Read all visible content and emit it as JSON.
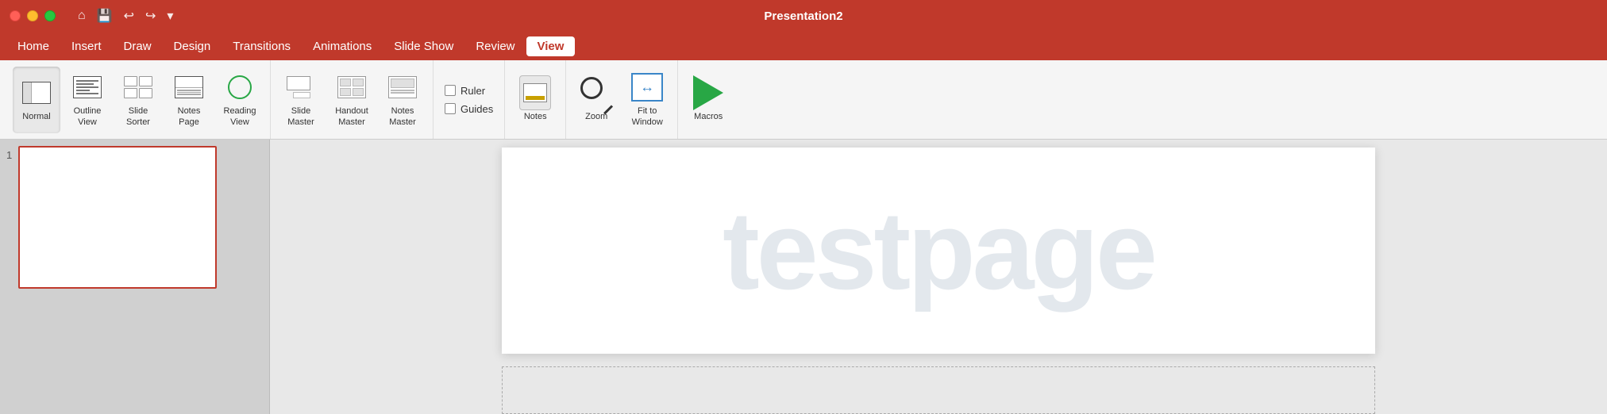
{
  "titleBar": {
    "title": "Presentation2",
    "trafficLights": {
      "close": "close",
      "minimize": "minimize",
      "maximize": "maximize"
    },
    "controls": [
      "home-icon",
      "save-icon",
      "undo-icon",
      "redo-icon",
      "customize-icon"
    ]
  },
  "menuBar": {
    "items": [
      {
        "id": "home",
        "label": "Home",
        "active": false
      },
      {
        "id": "insert",
        "label": "Insert",
        "active": false
      },
      {
        "id": "draw",
        "label": "Draw",
        "active": false
      },
      {
        "id": "design",
        "label": "Design",
        "active": false
      },
      {
        "id": "transitions",
        "label": "Transitions",
        "active": false
      },
      {
        "id": "animations",
        "label": "Animations",
        "active": false
      },
      {
        "id": "slideshow",
        "label": "Slide Show",
        "active": false
      },
      {
        "id": "review",
        "label": "Review",
        "active": false
      },
      {
        "id": "view",
        "label": "View",
        "active": true
      }
    ]
  },
  "toolbar": {
    "groups": [
      {
        "id": "presentation-views",
        "buttons": [
          {
            "id": "normal",
            "label": "Normal",
            "active": true
          },
          {
            "id": "outline-view",
            "label": "Outline\nView",
            "active": false
          },
          {
            "id": "slide-sorter",
            "label": "Slide\nSorter",
            "active": false
          },
          {
            "id": "notes-page",
            "label": "Notes\nPage",
            "active": false
          },
          {
            "id": "reading-view",
            "label": "Reading\nView",
            "active": false
          }
        ]
      },
      {
        "id": "master-views",
        "buttons": [
          {
            "id": "slide-master",
            "label": "Slide\nMaster",
            "active": false
          },
          {
            "id": "handout-master",
            "label": "Handout\nMaster",
            "active": false
          },
          {
            "id": "notes-master",
            "label": "Notes\nMaster",
            "active": false
          }
        ]
      },
      {
        "id": "show-group",
        "checkboxes": [
          {
            "id": "ruler",
            "label": "Ruler",
            "checked": false
          },
          {
            "id": "guides",
            "label": "Guides",
            "checked": false
          }
        ]
      },
      {
        "id": "notes-group",
        "buttons": [
          {
            "id": "notes",
            "label": "Notes",
            "active": false
          }
        ]
      },
      {
        "id": "zoom-group",
        "buttons": [
          {
            "id": "zoom",
            "label": "Zoom",
            "active": false
          },
          {
            "id": "fit-to-window",
            "label": "Fit to\nWindow",
            "active": false
          }
        ]
      },
      {
        "id": "macros-group",
        "buttons": [
          {
            "id": "macros",
            "label": "Macros",
            "active": false
          }
        ]
      }
    ]
  },
  "slidePanel": {
    "slideNumber": "1"
  },
  "slideCanvas": {
    "watermark": "testpage"
  }
}
